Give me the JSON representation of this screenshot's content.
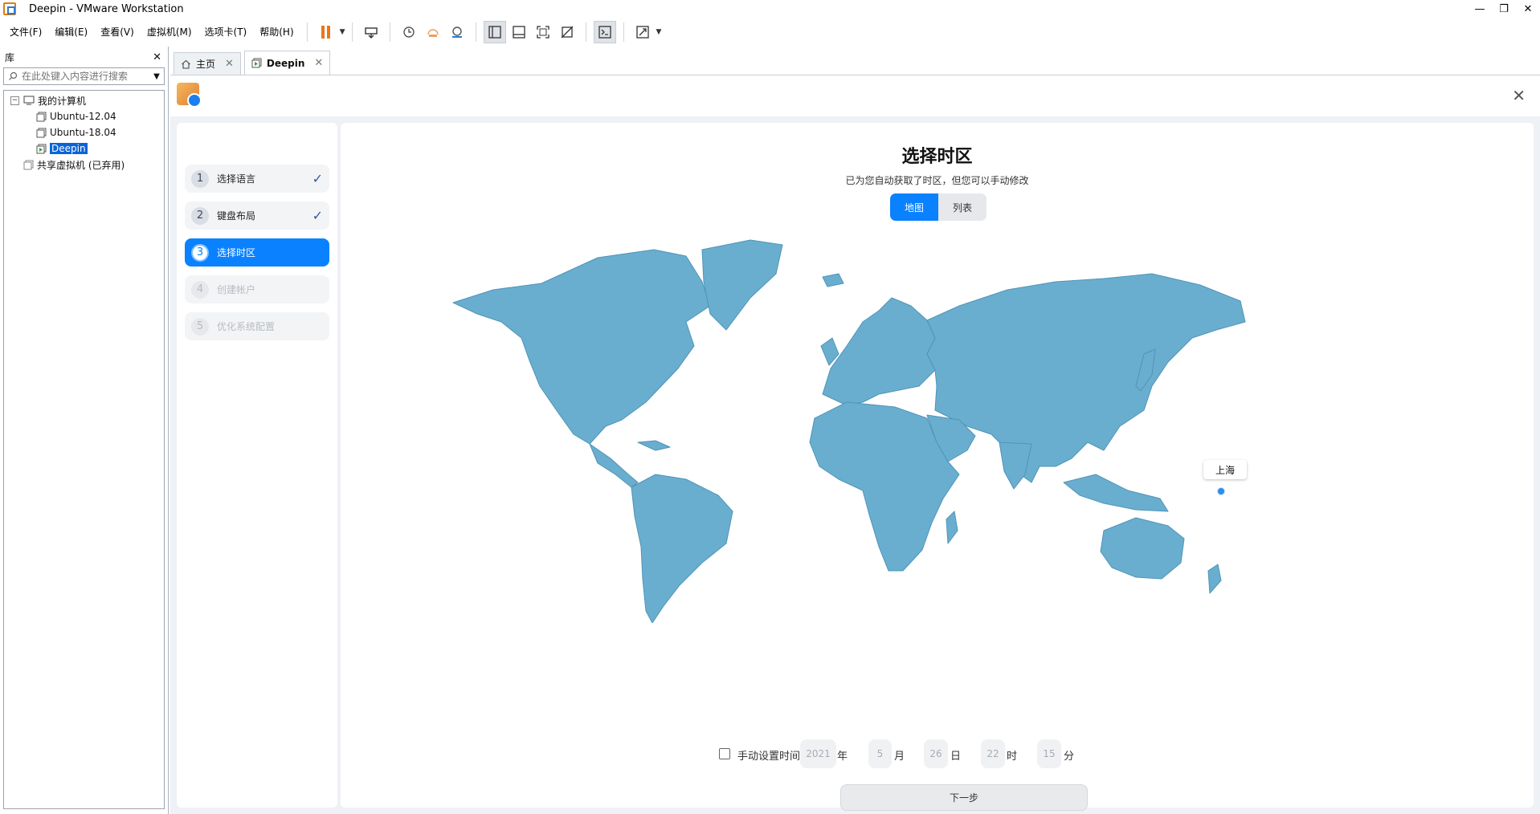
{
  "window": {
    "title": "Deepin - VMware Workstation"
  },
  "menu": {
    "items": [
      "文件(F)",
      "编辑(E)",
      "查看(V)",
      "虚拟机(M)",
      "选项卡(T)",
      "帮助(H)"
    ]
  },
  "library": {
    "title": "库",
    "search_placeholder": "在此处键入内容进行搜索",
    "root": "我的计算机",
    "vms": [
      "Ubuntu-12.04",
      "Ubuntu-18.04",
      "Deepin"
    ],
    "shared": "共享虚拟机 (已弃用)"
  },
  "tabs": [
    {
      "label": "主页"
    },
    {
      "label": "Deepin"
    }
  ],
  "installer": {
    "steps": [
      {
        "num": "1",
        "label": "选择语言",
        "state": "done"
      },
      {
        "num": "2",
        "label": "键盘布局",
        "state": "done"
      },
      {
        "num": "3",
        "label": "选择时区",
        "state": "active"
      },
      {
        "num": "4",
        "label": "创建帐户",
        "state": "disabled"
      },
      {
        "num": "5",
        "label": "优化系统配置",
        "state": "disabled"
      }
    ],
    "title": "选择时区",
    "subtitle": "已为您自动获取了时区，但您可以手动修改",
    "view_toggle": {
      "map": "地图",
      "list": "列表"
    },
    "selected_timezone": "上海",
    "manual_time": {
      "label": "手动设置时间",
      "year": "2021",
      "year_unit": "年",
      "month": "5",
      "month_unit": "月",
      "day": "26",
      "day_unit": "日",
      "hour": "22",
      "hour_unit": "时",
      "minute": "15",
      "minute_unit": "分"
    },
    "next_label": "下一步"
  },
  "colors": {
    "accent": "#0a81ff",
    "map_land": "#6aaecf",
    "pause": "#e8771c"
  }
}
